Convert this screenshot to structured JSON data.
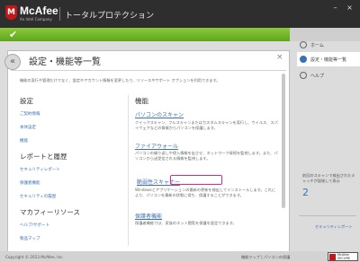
{
  "header": {
    "brand": "McAfee",
    "brand_sub": "An Intel Company",
    "app_title": "トータルプロテクション",
    "minimize": "–",
    "close": "×"
  },
  "status_check": "✔",
  "panel": {
    "back": "«",
    "title": "設定・機能等一覧",
    "close": "×",
    "description": "機能の実行や管理だけでなく、設定やアカウント情報を変更したり、リソースやサポート オプションを利用できます。"
  },
  "settings": {
    "heading": "設定",
    "links": [
      "ご契約情報",
      "本体設定",
      "機能"
    ]
  },
  "reports": {
    "heading": "レポートと履歴",
    "links": [
      "セキュリティレポート",
      "保護者機能",
      "セキュリティの履歴"
    ]
  },
  "resources": {
    "heading": "マカフィーリソース",
    "links": [
      "ヘルプ/サポート",
      "製品マップ"
    ]
  },
  "features": {
    "heading": "機能",
    "items": [
      {
        "title": "パソコンのスキャン",
        "desc": "クイックスキャン、フルスキャンまたはカスタムスキャンを実行し、ウイルス、スパイウェアなどの脅威からパソコンを保護します。"
      },
      {
        "title": "ファイアウォール",
        "desc": "パソコンの繰り返しや侵入情報を出させ、ネットワーク接続を監視します。また、パソコンから送受信される情報を監視します。"
      },
      {
        "title": "脆弱性スキャナー",
        "desc": "Windowsとアプリケーションの最新の更新を検出してインストールします。これにより、パソコンを最新の状態に保ち、保護することができます。"
      },
      {
        "title": "保護者機能",
        "desc": "保護者機能では、家族のネット閲覧を保護を設定できます。"
      }
    ]
  },
  "sidebar": {
    "items": [
      {
        "label": "ホーム",
        "icon": "home-icon"
      },
      {
        "label": "設定・機能等一覧",
        "icon": "list-icon"
      },
      {
        "label": "ヘルプ",
        "icon": "help-icon"
      }
    ],
    "pending_text": "前回のスキャンで検出されたキャッチが誤検して表示",
    "pending_count": "2",
    "security_link": "セキュリティレポート"
  },
  "footer": {
    "copyright": "Copyright © 2013 McAfee, Inc.",
    "links": "機能マップ | パソコンの保護",
    "secure_badge": "McAfee SECURE"
  },
  "colors": {
    "accent_green": "#6ab426",
    "link_blue": "#3a73b5",
    "highlight_pink": "#e0278a",
    "brand_red": "#c01818"
  }
}
